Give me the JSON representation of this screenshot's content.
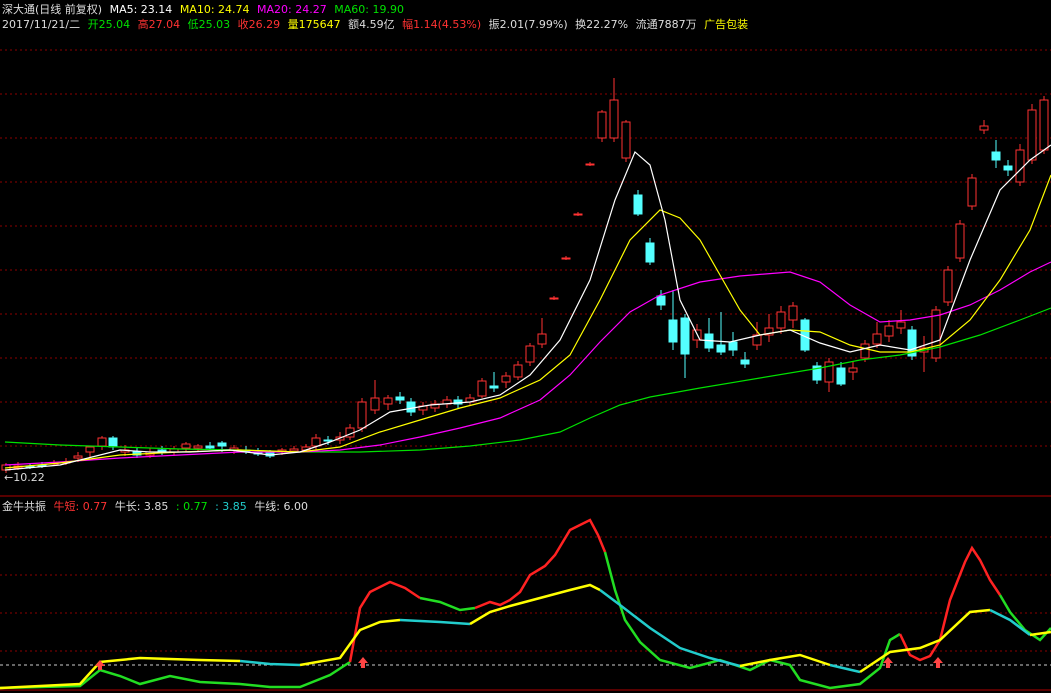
{
  "header": {
    "title": "深大通(日线 前复权)",
    "ma5": "MA5: 23.14",
    "ma10": "MA10: 24.74",
    "ma20": "MA20: 24.27",
    "ma60": "MA60: 19.90",
    "date": "2017/11/21/二",
    "open": "开25.04",
    "high": "高27.04",
    "low": "低25.03",
    "close": "收26.29",
    "volume": "量175647",
    "amount": "额4.59亿",
    "change": "幅1.14(4.53%)",
    "amplitude": "振2.01(7.99%)",
    "turnover": "换22.27%",
    "float": "流通7887万",
    "sector": "广告包装"
  },
  "low_marker": "←10.22",
  "indicator": {
    "name": "金牛共振",
    "short": "牛短: 0.77",
    "long": "牛长: 3.85",
    "v1": ": 0.77",
    "v2": ": 3.85",
    "line": "牛线: 6.00"
  },
  "colors": {
    "up": "#ff3232",
    "down": "#54ffff",
    "ma5": "#ffffff",
    "ma10": "#ffff00",
    "ma20": "#ff00ff",
    "ma60": "#00e000",
    "grid": "#8b0000"
  },
  "chart_data": {
    "type": "candlestick",
    "ma_periods": [
      5,
      10,
      20,
      60
    ],
    "visible_low": 10.22
  }
}
